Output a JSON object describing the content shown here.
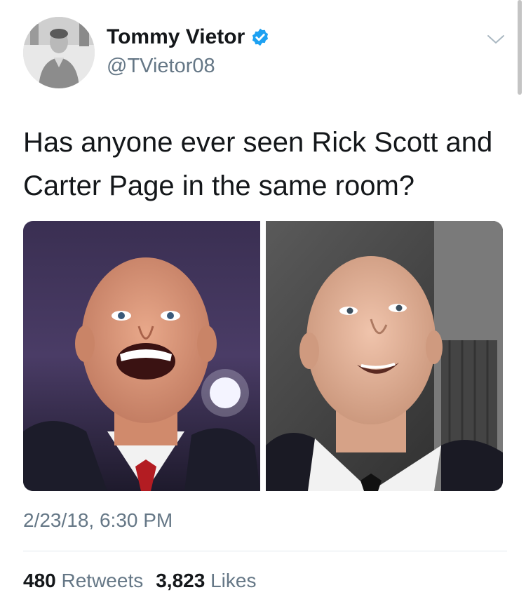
{
  "author": {
    "display_name": "Tommy Vietor",
    "handle": "@TVietor08",
    "verified": true,
    "avatar_icon": "profile-photo"
  },
  "tweet": {
    "text": "Has anyone ever seen Rick Scott and Carter Page in the same room?",
    "timestamp": "2/23/18, 6:30 PM",
    "media": [
      {
        "description_icon": "photo-left"
      },
      {
        "description_icon": "photo-right"
      }
    ]
  },
  "stats": {
    "retweets_count": "480",
    "retweets_label": "Retweets",
    "likes_count": "3,823",
    "likes_label": "Likes"
  },
  "colors": {
    "verified_blue": "#1da1f2",
    "secondary_text": "#657786",
    "primary_text": "#14171a"
  }
}
